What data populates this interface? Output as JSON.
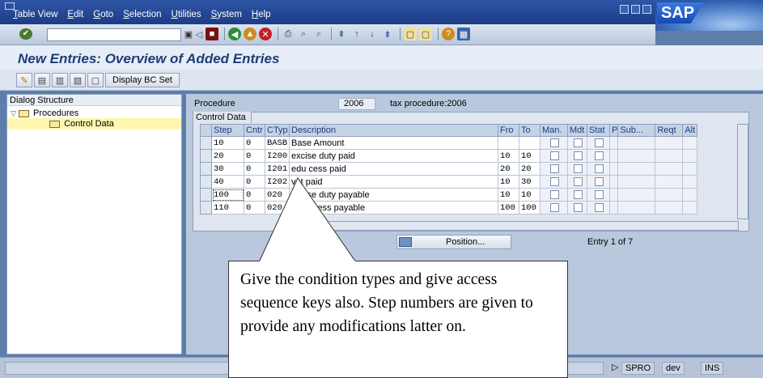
{
  "menubar": {
    "items": [
      "Table View",
      "Edit",
      "Goto",
      "Selection",
      "Utilities",
      "System",
      "Help"
    ],
    "logo": "SAP"
  },
  "toolbar": {
    "command_field": "",
    "icons": [
      "enter-icon",
      "save-icon",
      "back-icon",
      "exit-icon",
      "cancel-icon",
      "print-icon",
      "find-icon",
      "find-next-icon",
      "first-page-icon",
      "prev-page-icon",
      "next-page-icon",
      "last-page-icon",
      "create-session-icon",
      "shortcut-icon",
      "help-icon",
      "layout-icon"
    ]
  },
  "title": "New Entries: Overview of Added Entries",
  "app_toolbar": {
    "display_bc_set": "Display BC Set"
  },
  "dialog_structure": {
    "header": "Dialog Structure",
    "items": [
      {
        "label": "Procedures",
        "expanded": true
      },
      {
        "label": "Control Data",
        "selected": true
      }
    ]
  },
  "procedure": {
    "label": "Procedure",
    "value": "2006",
    "description": "tax procedure:2006"
  },
  "control_data": {
    "tab": "Control Data",
    "columns": [
      "Step",
      "Cntr",
      "CTyp",
      "Description",
      "Fro",
      "To",
      "Man.",
      "Mdt",
      "Stat",
      "P",
      "Sub...",
      "Reqt",
      "Alt"
    ],
    "rows": [
      {
        "step": "10",
        "cntr": "0",
        "ctyp": "BASB",
        "desc": "Base Amount",
        "fro": "",
        "to": ""
      },
      {
        "step": "20",
        "cntr": "0",
        "ctyp": "I200",
        "desc": "excise duty paid",
        "fro": "10",
        "to": "10"
      },
      {
        "step": "30",
        "cntr": "0",
        "ctyp": "I201",
        "desc": "edu cess paid",
        "fro": "20",
        "to": "20"
      },
      {
        "step": "40",
        "cntr": "0",
        "ctyp": "I202",
        "desc": "vat paid",
        "fro": "10",
        "to": "30"
      },
      {
        "step": "100",
        "cntr": "0",
        "ctyp": "020",
        "desc": "excise duty payable",
        "fro": "10",
        "to": "10"
      },
      {
        "step": "110",
        "cntr": "0",
        "ctyp": "020",
        "desc": "educ cess payable",
        "fro": "100",
        "to": "100"
      }
    ]
  },
  "position_button": "Position...",
  "entry_info": "Entry 1 of 7",
  "status": {
    "transaction": "SPRO",
    "system": "dev",
    "mode": "INS"
  },
  "callout": {
    "text": "Give the condition types and give access sequence keys also. Step numbers are given to provide any modifications latter on."
  }
}
